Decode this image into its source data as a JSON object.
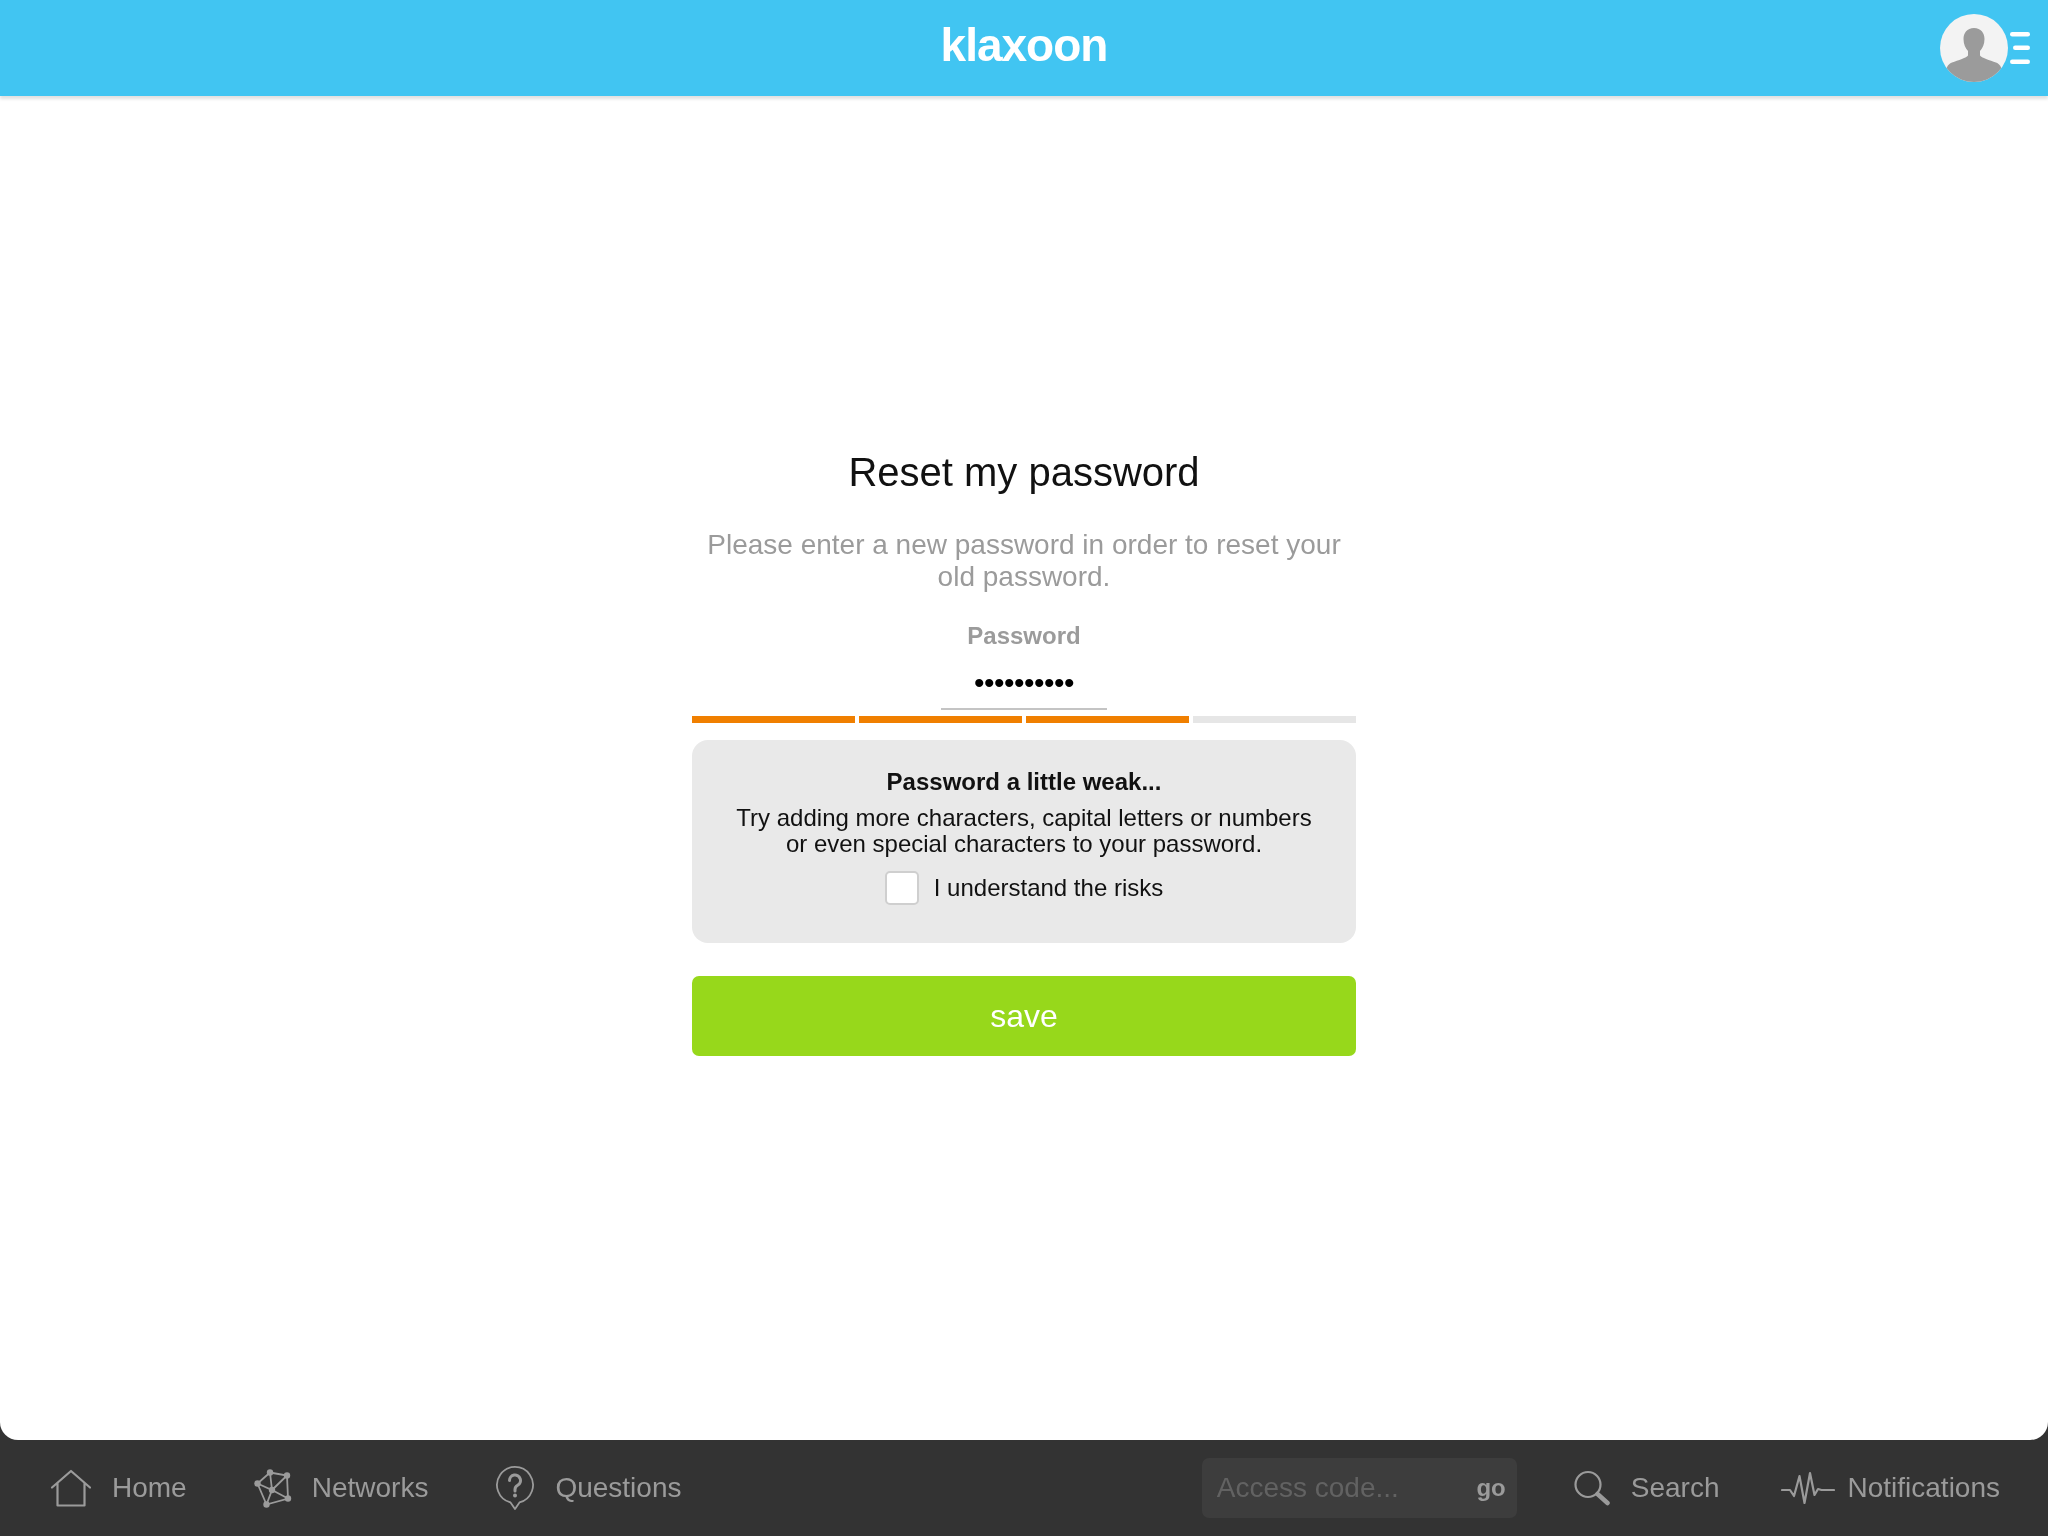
{
  "header": {
    "logo": "klaxoon"
  },
  "reset_form": {
    "title": "Reset my password",
    "description": "Please enter a new password in order to reset your old password.",
    "password": {
      "label": "Password",
      "value": "••••••••••",
      "strength": {
        "level": 0.75
      }
    },
    "warning": {
      "title": "Password a little weak...",
      "message": "Try adding more characters, capital letters or numbers or even special characters to your password.",
      "risk_checkbox": {
        "label": "I understand the risks",
        "checked": false
      }
    },
    "save_button": {
      "label": "save"
    }
  },
  "bottom_bar": {
    "nav_items": [
      {
        "label": "Home"
      },
      {
        "label": "Networks"
      },
      {
        "label": "Questions"
      }
    ],
    "access_code": {
      "placeholder": "Access code...",
      "button": "go"
    },
    "tools": [
      {
        "label": "Search"
      },
      {
        "label": "Notifications"
      }
    ]
  }
}
